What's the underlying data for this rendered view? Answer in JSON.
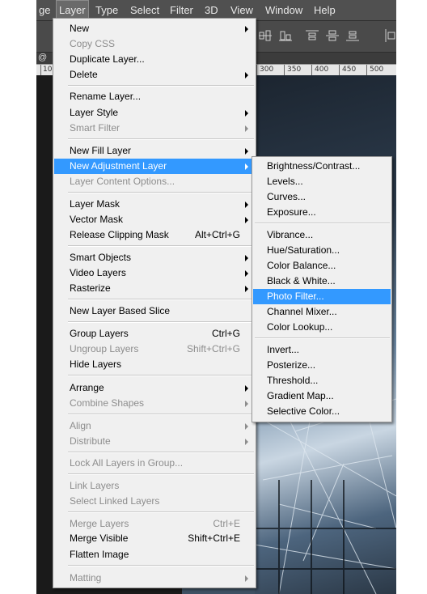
{
  "menubar": {
    "items": [
      {
        "label": "ge"
      },
      {
        "label": "Layer"
      },
      {
        "label": "Type"
      },
      {
        "label": "Select"
      },
      {
        "label": "Filter"
      },
      {
        "label": "3D"
      },
      {
        "label": "View"
      },
      {
        "label": "Window"
      },
      {
        "label": "Help"
      }
    ]
  },
  "ruler": {
    "left_label": "@",
    "numbers": [
      "10",
      "300",
      "350",
      "400",
      "450",
      "500"
    ]
  },
  "layer_menu": {
    "items": [
      {
        "label": "New",
        "submenu": true
      },
      {
        "label": "Copy CSS",
        "disabled": true
      },
      {
        "label": "Duplicate Layer..."
      },
      {
        "label": "Delete",
        "submenu": true
      },
      {
        "label": "Rename Layer..."
      },
      {
        "label": "Layer Style",
        "submenu": true
      },
      {
        "label": "Smart Filter",
        "disabled": true,
        "submenu": true
      },
      {
        "label": "New Fill Layer",
        "submenu": true
      },
      {
        "label": "New Adjustment Layer",
        "submenu": true,
        "highlighted": true
      },
      {
        "label": "Layer Content Options...",
        "disabled": true
      },
      {
        "label": "Layer Mask",
        "submenu": true
      },
      {
        "label": "Vector Mask",
        "submenu": true
      },
      {
        "label": "Release Clipping Mask",
        "shortcut": "Alt+Ctrl+G"
      },
      {
        "label": "Smart Objects",
        "submenu": true
      },
      {
        "label": "Video Layers",
        "submenu": true
      },
      {
        "label": "Rasterize",
        "submenu": true
      },
      {
        "label": "New Layer Based Slice"
      },
      {
        "label": "Group Layers",
        "shortcut": "Ctrl+G"
      },
      {
        "label": "Ungroup Layers",
        "shortcut": "Shift+Ctrl+G",
        "disabled": true
      },
      {
        "label": "Hide Layers"
      },
      {
        "label": "Arrange",
        "submenu": true
      },
      {
        "label": "Combine Shapes",
        "disabled": true,
        "submenu": true
      },
      {
        "label": "Align",
        "disabled": true,
        "submenu": true
      },
      {
        "label": "Distribute",
        "disabled": true,
        "submenu": true
      },
      {
        "label": "Lock All Layers in Group...",
        "disabled": true
      },
      {
        "label": "Link Layers",
        "disabled": true
      },
      {
        "label": "Select Linked Layers",
        "disabled": true
      },
      {
        "label": "Merge Layers",
        "shortcut": "Ctrl+E",
        "disabled": true
      },
      {
        "label": "Merge Visible",
        "shortcut": "Shift+Ctrl+E"
      },
      {
        "label": "Flatten Image"
      },
      {
        "label": "Matting",
        "disabled": true,
        "submenu": true
      }
    ]
  },
  "adjustment_menu": {
    "items": [
      {
        "label": "Brightness/Contrast..."
      },
      {
        "label": "Levels..."
      },
      {
        "label": "Curves..."
      },
      {
        "label": "Exposure..."
      },
      {
        "label": "Vibrance..."
      },
      {
        "label": "Hue/Saturation..."
      },
      {
        "label": "Color Balance..."
      },
      {
        "label": "Black & White..."
      },
      {
        "label": "Photo Filter...",
        "highlighted": true
      },
      {
        "label": "Channel Mixer..."
      },
      {
        "label": "Color Lookup..."
      },
      {
        "label": "Invert..."
      },
      {
        "label": "Posterize..."
      },
      {
        "label": "Threshold..."
      },
      {
        "label": "Gradient Map..."
      },
      {
        "label": "Selective Color..."
      }
    ]
  },
  "colors": {
    "highlight": "#3399ff",
    "menu_bg": "#f0f0f0",
    "disabled_text": "#8d8d8d"
  }
}
